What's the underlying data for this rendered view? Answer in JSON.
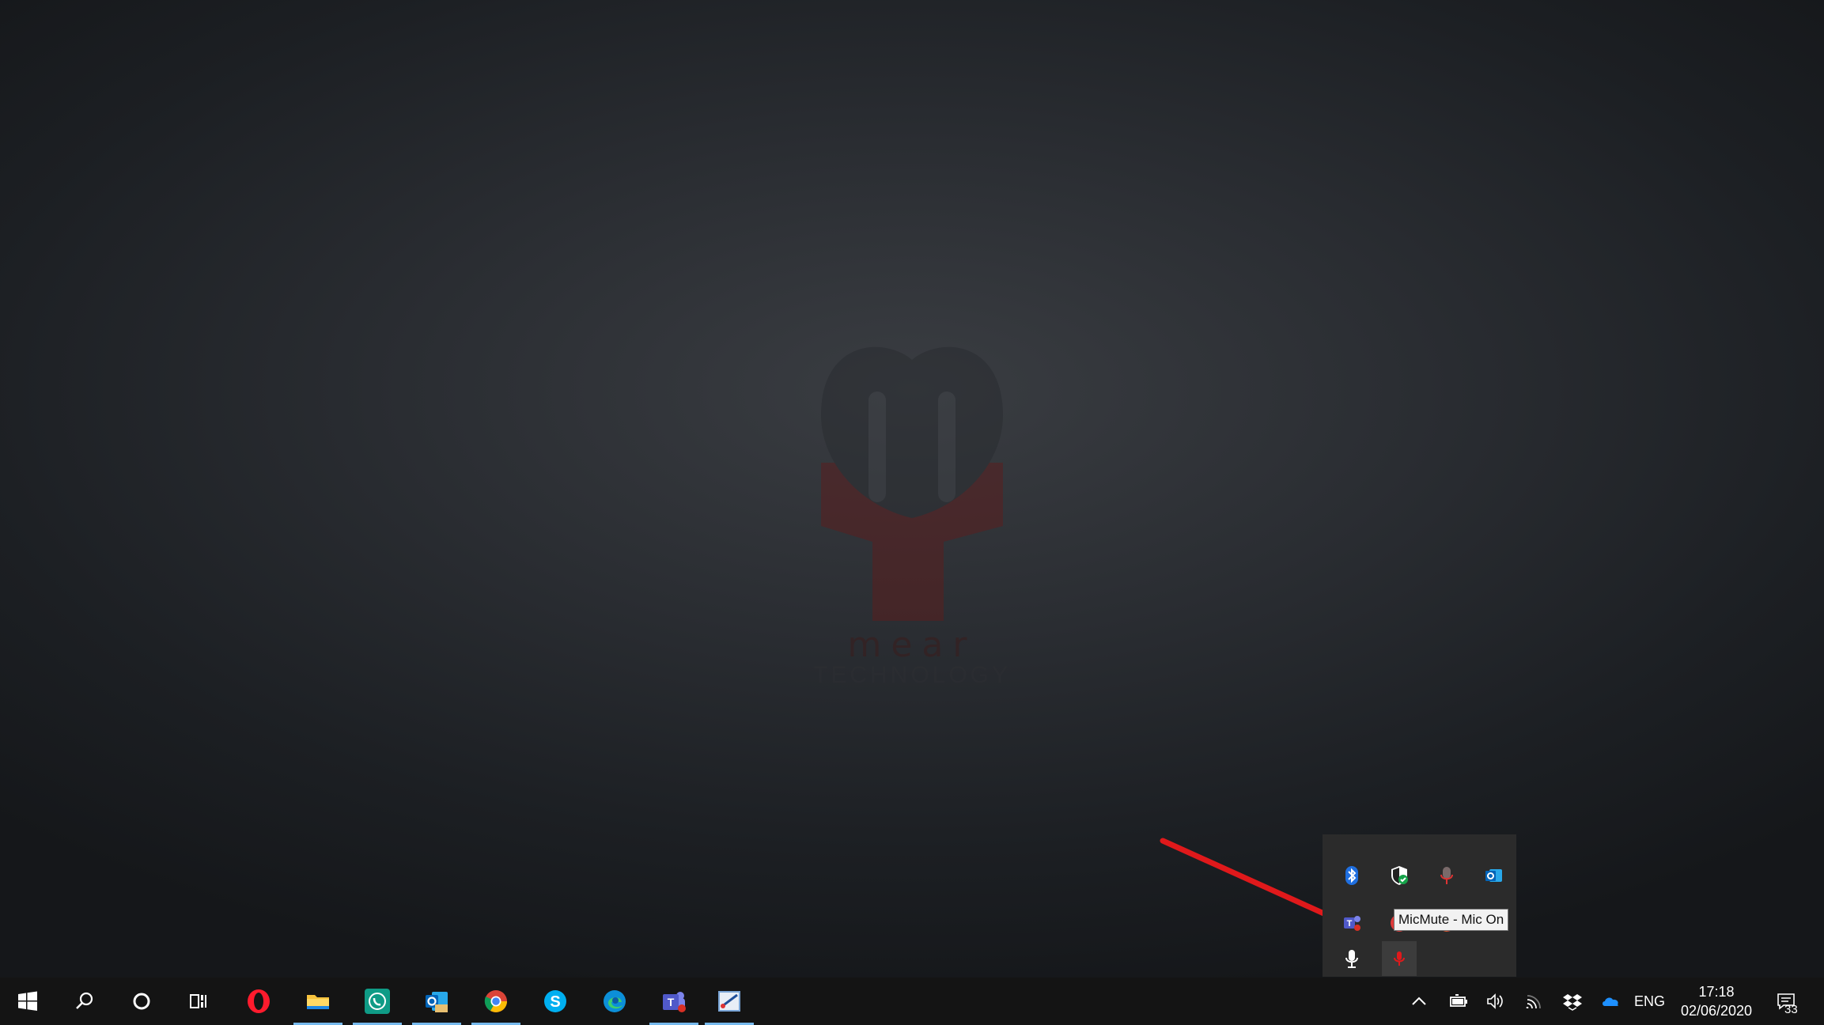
{
  "desktop": {
    "logo": {
      "word1": "mear",
      "word2": "TECHNOLOGY",
      "colors": {
        "dark": "#2a2d31",
        "red": "#5a1f1f"
      }
    }
  },
  "tray_flyout": {
    "icons": [
      {
        "name": "bluetooth-icon"
      },
      {
        "name": "windows-security-icon"
      },
      {
        "name": "micmute-tray-icon"
      },
      {
        "name": "outlook-tray-icon"
      },
      {
        "name": "teams-tray-icon"
      },
      {
        "name": "red-app-tray-icon"
      },
      {
        "name": "chrome-tray-icon"
      },
      {
        "name": "mail-tray-icon"
      },
      {
        "name": "microphone-tray-icon"
      },
      {
        "name": "micmute-red-mic-icon"
      }
    ],
    "tooltip": "MicMute - Mic On"
  },
  "taskbar": {
    "pinned": [
      {
        "name": "start-button"
      },
      {
        "name": "search-button"
      },
      {
        "name": "cortana-button"
      },
      {
        "name": "task-view-button"
      },
      {
        "name": "opera-app"
      },
      {
        "name": "file-explorer-app"
      },
      {
        "name": "whatsapp-app"
      },
      {
        "name": "outlook-app"
      },
      {
        "name": "chrome-app"
      },
      {
        "name": "skype-app"
      },
      {
        "name": "edge-app"
      },
      {
        "name": "teams-app"
      },
      {
        "name": "snipping-app"
      }
    ],
    "system_tray": {
      "language": "ENG",
      "time": "17:18",
      "date": "02/06/2020",
      "notification_count": "33"
    }
  },
  "colors": {
    "accent": "#76b9ed",
    "arrow": "#e0191b",
    "taskbar": "#141414"
  }
}
